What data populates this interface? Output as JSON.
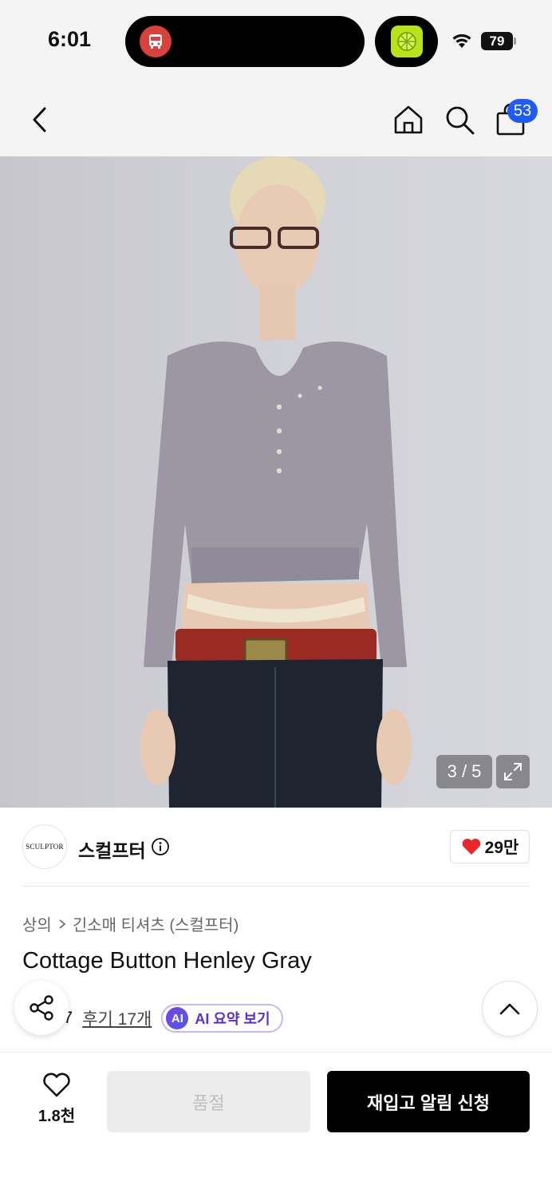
{
  "status_bar": {
    "time": "6:01",
    "battery": "79",
    "left_island_icon": "bus-icon",
    "right_island_icon": "lime-app-icon"
  },
  "nav": {
    "back_icon": "chevron-left-icon",
    "home_icon": "home-icon",
    "search_icon": "search-icon",
    "bag_icon": "shopping-bag-icon",
    "bag_count": "53"
  },
  "gallery": {
    "counter": "3 / 5",
    "expand_icon": "expand-icon"
  },
  "brand": {
    "logo_text": "SCULPTOR",
    "name": "스컬프터",
    "likes": "29만",
    "heart_color": "#e8262b"
  },
  "product": {
    "breadcrumb": [
      "상의",
      "긴소매 티셔츠 (스컬프터)"
    ],
    "title": "Cottage Button Henley Gray",
    "rating": "4.7",
    "reviews": "후기 17개",
    "ai_badge": "AI",
    "ai_summary": "AI 요약 보기"
  },
  "bottom_bar": {
    "wish_count": "1.8천",
    "soldout_label": "품절",
    "restock_label": "재입고 알림 신청"
  }
}
